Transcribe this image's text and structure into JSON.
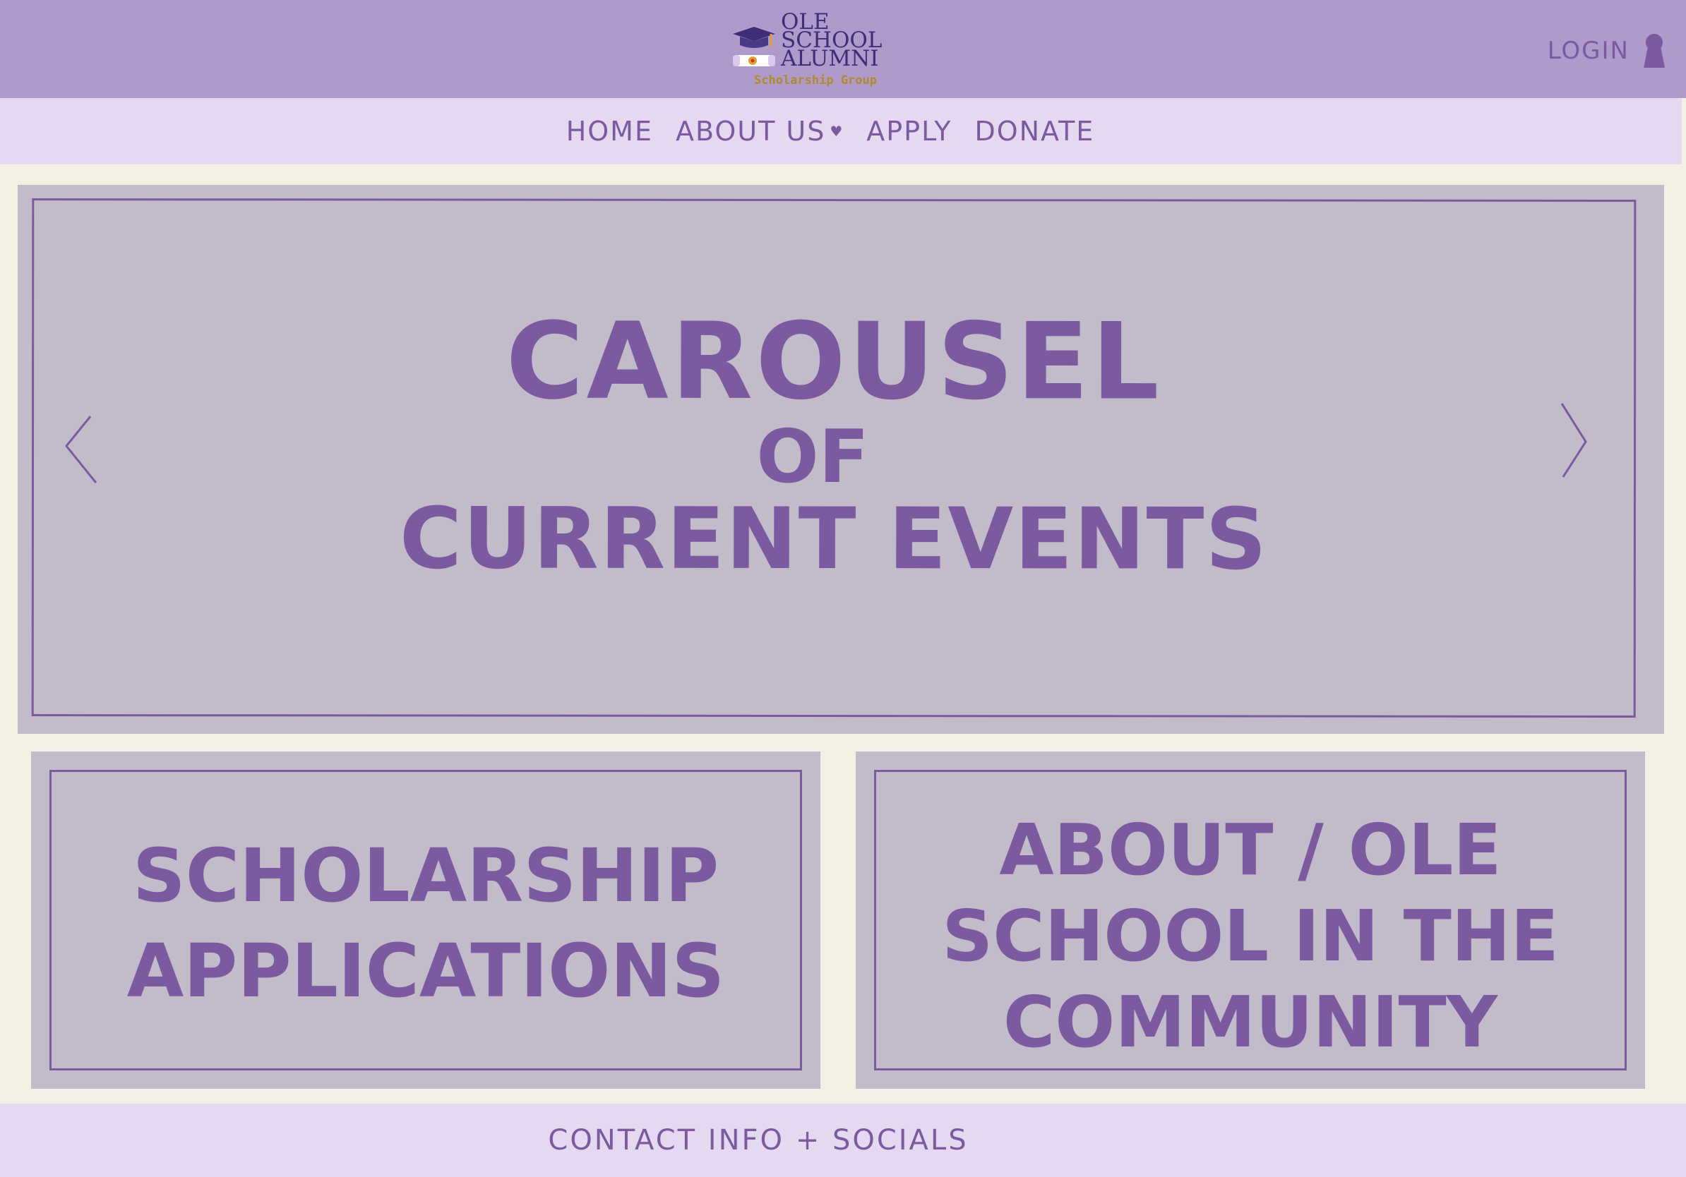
{
  "header": {
    "logo": {
      "line1": "OLE",
      "line2": "SCHOOL",
      "line3": "ALUMNI",
      "subtitle": "Scholarship Group",
      "icon": "graduation-cap-diploma-icon"
    },
    "login_label": "LOGIN",
    "login_icon": "keyhole-icon"
  },
  "nav": {
    "items": [
      {
        "label": "HOME"
      },
      {
        "label": "ABOUT US",
        "has_dropdown": true,
        "dropdown_icon": "heart-icon"
      },
      {
        "label": "APPLY"
      },
      {
        "label": "DONATE"
      }
    ]
  },
  "carousel": {
    "line1": "CAROUSEL",
    "line2": "OF",
    "line3": "CURRENT EVENTS",
    "prev_icon": "chevron-left-icon",
    "next_icon": "chevron-right-icon"
  },
  "cards": {
    "left": {
      "line1": "SCHOLARSHIP",
      "line2": "APPLICATIONS"
    },
    "right": {
      "line1": "ABOUT / OLE",
      "line2": "SCHOOL IN THE",
      "line3": "COMMUNITY"
    }
  },
  "footer": {
    "text": "CONTACT INFO + SOCIALS"
  },
  "colors": {
    "header_bg": "#ae9acb",
    "nav_bg": "#e5d9f2",
    "page_bg": "#f2efe3",
    "panel_bg": "#c1bbca",
    "accent": "#7b5aa0",
    "logo_text": "#3f2d77",
    "logo_gold": "#b08a2a"
  }
}
